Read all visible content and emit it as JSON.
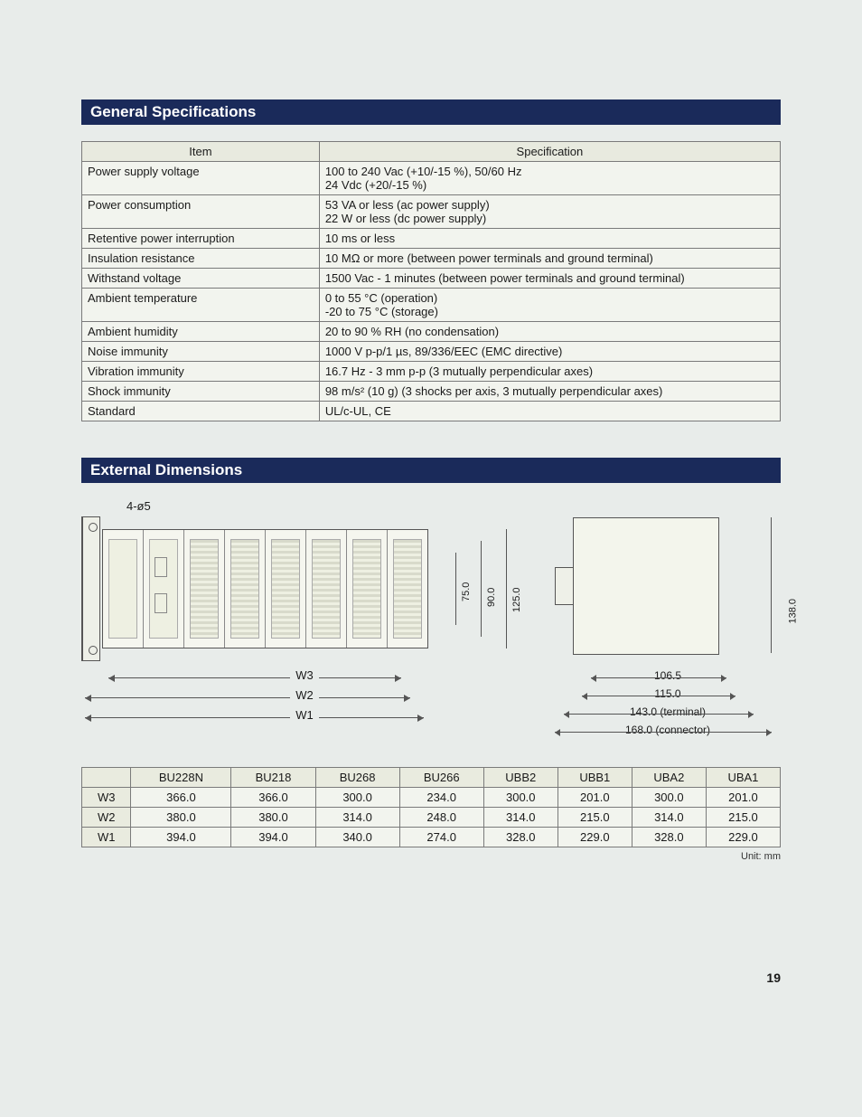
{
  "sections": {
    "general": "General Specifications",
    "dimensions": "External Dimensions"
  },
  "spec_table": {
    "headers": {
      "item": "Item",
      "spec": "Specification"
    },
    "rows": [
      {
        "item": "Power supply voltage",
        "spec": "100 to 240 Vac (+10/-15 %), 50/60 Hz\n24 Vdc (+20/-15 %)"
      },
      {
        "item": "Power consumption",
        "spec": "53 VA or less (ac power supply)\n22 W or less (dc power supply)"
      },
      {
        "item": "Retentive power interruption",
        "spec": "10 ms or less"
      },
      {
        "item": "Insulation resistance",
        "spec": "10 MΩ or more (between power terminals and ground terminal)"
      },
      {
        "item": "Withstand voltage",
        "spec": "1500 Vac - 1 minutes (between power terminals and ground terminal)"
      },
      {
        "item": "Ambient temperature",
        "spec": "0 to 55 °C (operation)\n-20 to 75 °C (storage)"
      },
      {
        "item": "Ambient humidity",
        "spec": "20 to 90 % RH (no condensation)"
      },
      {
        "item": "Noise immunity",
        "spec": "1000 V p-p/1 µs, 89/336/EEC (EMC directive)"
      },
      {
        "item": "Vibration immunity",
        "spec": "16.7 Hz - 3 mm p-p (3 mutually perpendicular axes)"
      },
      {
        "item": "Shock immunity",
        "spec": "98 m/s² (10 g) (3 shocks per axis, 3 mutually perpendicular axes)"
      },
      {
        "item": "Standard",
        "spec": "UL/c-UL, CE"
      }
    ]
  },
  "drawing": {
    "hole_label": "4-ø5",
    "front_heights": {
      "h1": "75.0",
      "h2": "90.0",
      "h3": "125.0"
    },
    "side_height": "138.0",
    "widths": {
      "w1": "W1",
      "w2": "W2",
      "w3": "W3"
    },
    "side_widths": {
      "d1": "106.5",
      "d2": "115.0",
      "d3": "143.0 (terminal)",
      "d4": "168.0 (connector)"
    }
  },
  "dim_table": {
    "headers": [
      "",
      "BU228N",
      "BU218",
      "BU268",
      "BU266",
      "UBB2",
      "UBB1",
      "UBA2",
      "UBA1"
    ],
    "rows": [
      {
        "label": "W3",
        "vals": [
          "366.0",
          "366.0",
          "300.0",
          "234.0",
          "300.0",
          "201.0",
          "300.0",
          "201.0"
        ]
      },
      {
        "label": "W2",
        "vals": [
          "380.0",
          "380.0",
          "314.0",
          "248.0",
          "314.0",
          "215.0",
          "314.0",
          "215.0"
        ]
      },
      {
        "label": "W1",
        "vals": [
          "394.0",
          "394.0",
          "340.0",
          "274.0",
          "328.0",
          "229.0",
          "328.0",
          "229.0"
        ]
      }
    ]
  },
  "unit_note": "Unit: mm",
  "page_number": "19"
}
